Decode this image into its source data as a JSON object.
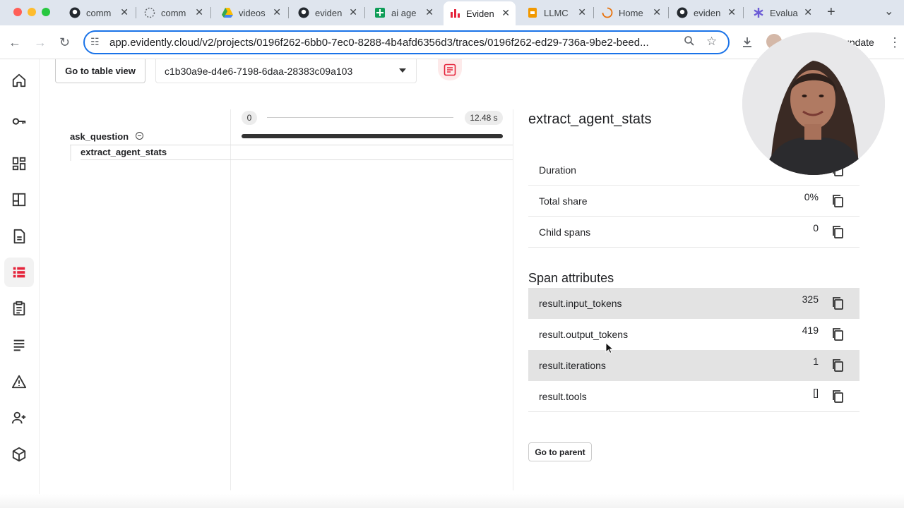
{
  "browser": {
    "tabs": [
      {
        "title": "comm",
        "icon": "github-icon"
      },
      {
        "title": "comm",
        "icon": "loading-icon"
      },
      {
        "title": "videos",
        "icon": "google-drive-icon"
      },
      {
        "title": "eviden",
        "icon": "github-icon"
      },
      {
        "title": "ai age",
        "icon": "google-sheets-icon"
      },
      {
        "title": "Eviden",
        "icon": "evidently-icon",
        "active": true
      },
      {
        "title": "LLMC",
        "icon": "slides-icon"
      },
      {
        "title": "Home",
        "icon": "spinner-icon"
      },
      {
        "title": "eviden",
        "icon": "github-icon"
      },
      {
        "title": "Evalua",
        "icon": "asterisk-icon"
      }
    ],
    "url": "app.evidently.cloud/v2/projects/0196f262-6bb0-7ec0-8288-4b4afd6356d3/traces/0196f262-ed29-736a-9be2-beed...",
    "update_label": "update"
  },
  "toolbar": {
    "table_view_label": "Go to table view",
    "trace_id": "c1b30a9e-d4e6-7198-6daa-28383c09a103"
  },
  "timeline": {
    "start_label": "0",
    "end_label": "12.48 s",
    "spans": [
      {
        "name": "ask_question",
        "start_fraction": 0.0,
        "end_fraction": 1.0
      },
      {
        "name": "extract_agent_stats"
      }
    ]
  },
  "details": {
    "title": "extract_agent_stats",
    "stats": [
      {
        "key": "Duration",
        "value": ""
      },
      {
        "key": "Total share",
        "value": "0%"
      },
      {
        "key": "Child spans",
        "value": "0"
      }
    ],
    "attributes_title": "Span attributes",
    "attributes": [
      {
        "key": "result.input_tokens",
        "value": "325"
      },
      {
        "key": "result.output_tokens",
        "value": "419"
      },
      {
        "key": "result.iterations",
        "value": "1"
      },
      {
        "key": "result.tools",
        "value": "[]"
      }
    ],
    "go_to_parent_label": "Go to parent"
  },
  "colors": {
    "accent": "#1a73e8",
    "brand_red": "#e5243b",
    "row_shade": "#e3e3e3"
  }
}
